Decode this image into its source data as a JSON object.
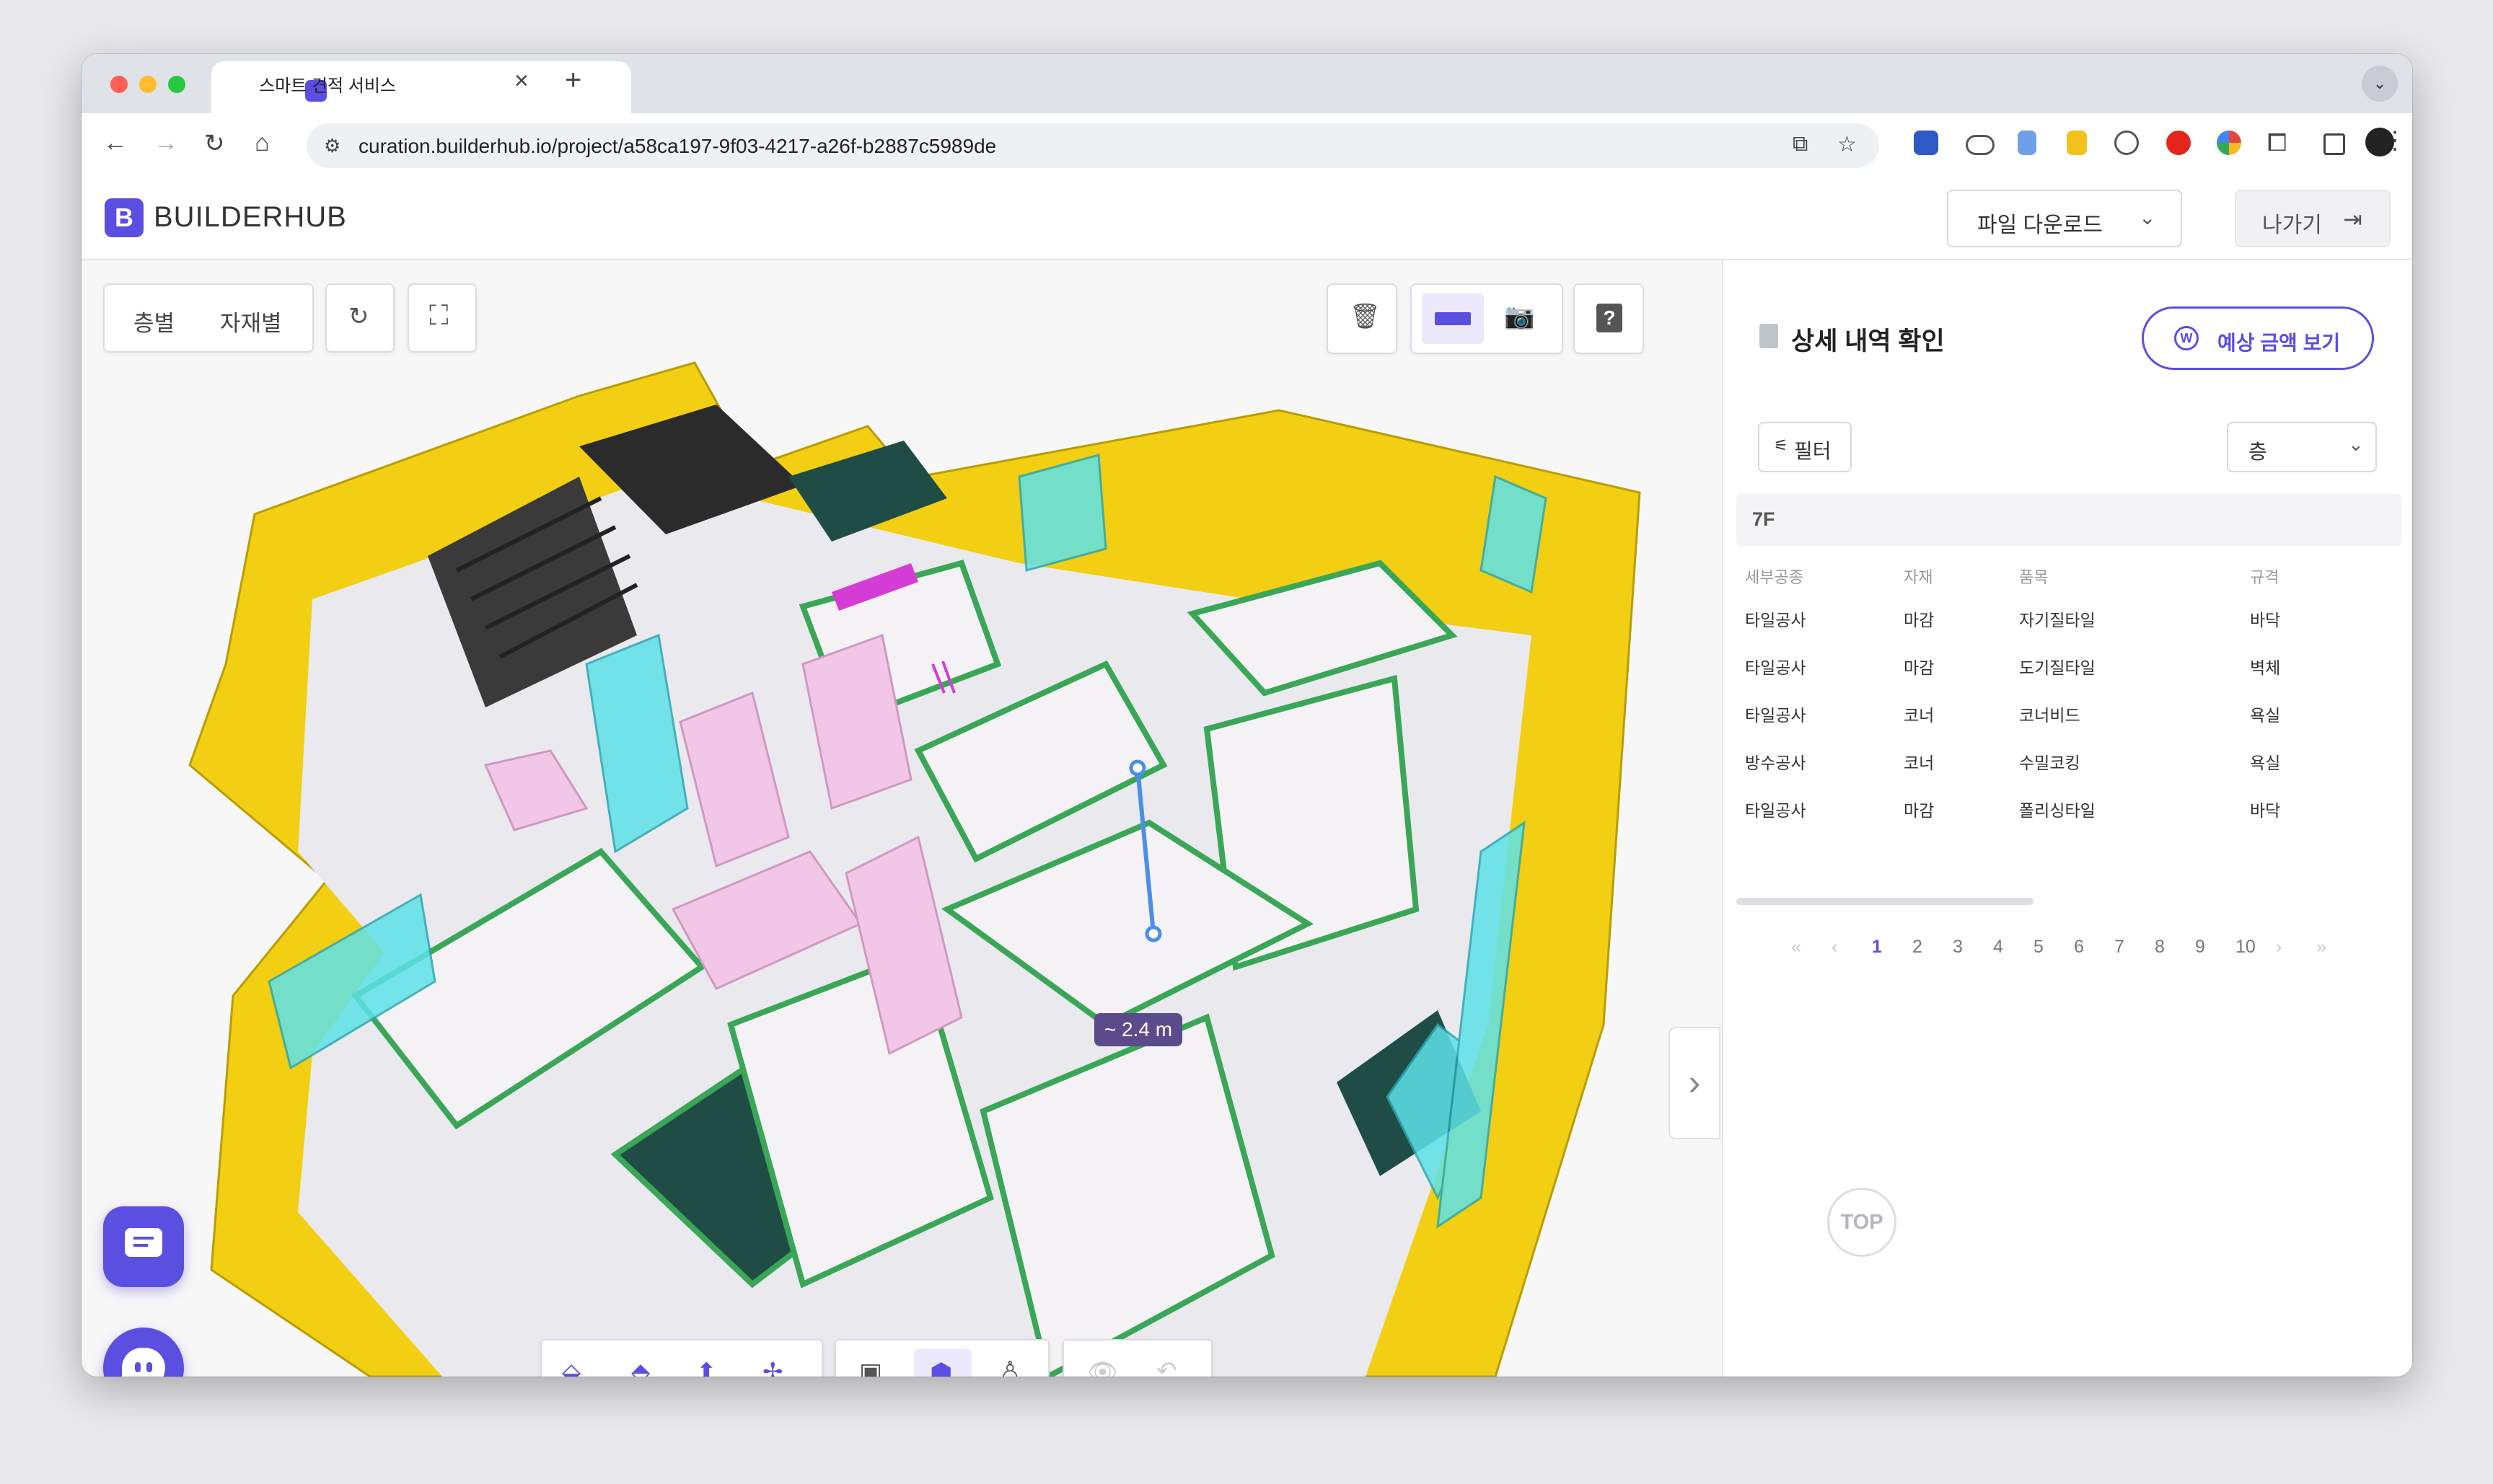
{
  "browser": {
    "tab_title": "스마트 견적 서비스",
    "tab_close": "×",
    "new_tab": "+",
    "url": "curation.builderhub.io/project/a58ca197-9f03-4217-a26f-b2887c5989de"
  },
  "app": {
    "logo_letter": "B",
    "logo_text": "BUILDERHUB",
    "download_label": "파일 다운로드",
    "exit_label": "나가기"
  },
  "viewer": {
    "view_modes": [
      "층별",
      "자재별"
    ],
    "measurement_label": "~ 2.4 m",
    "toggle_arrow": "›"
  },
  "panel": {
    "title": "상세 내역 확인",
    "price_button": "예상 금액 보기",
    "price_icon_letter": "W",
    "filter_label": "필터",
    "floor_select_value": "층",
    "floor_heading": "7F",
    "columns": [
      "세부공종",
      "자재",
      "품목",
      "규격"
    ],
    "rows": [
      [
        "타일공사",
        "마감",
        "자기질타일",
        "바닥"
      ],
      [
        "타일공사",
        "마감",
        "도기질타일",
        "벽체"
      ],
      [
        "타일공사",
        "코너",
        "코너비드",
        "욕실"
      ],
      [
        "방수공사",
        "코너",
        "수밀코킹",
        "욕실"
      ],
      [
        "타일공사",
        "마감",
        "폴리싱타일",
        "바닥"
      ]
    ],
    "pagination": {
      "first": "«",
      "prev": "‹",
      "next": "›",
      "last": "»",
      "pages": [
        "1",
        "2",
        "3",
        "4",
        "5",
        "6",
        "7",
        "8",
        "9",
        "10"
      ],
      "current_page": "1"
    },
    "top_button": "TOP"
  },
  "colors": {
    "accent": "#5b4fe1",
    "wall_yellow": "#f2cf12",
    "wall_green": "#3aa657",
    "glass_cyan": "#5de2e8",
    "furniture_pink": "#f2c6e6",
    "dark_teal": "#1f4d46"
  }
}
